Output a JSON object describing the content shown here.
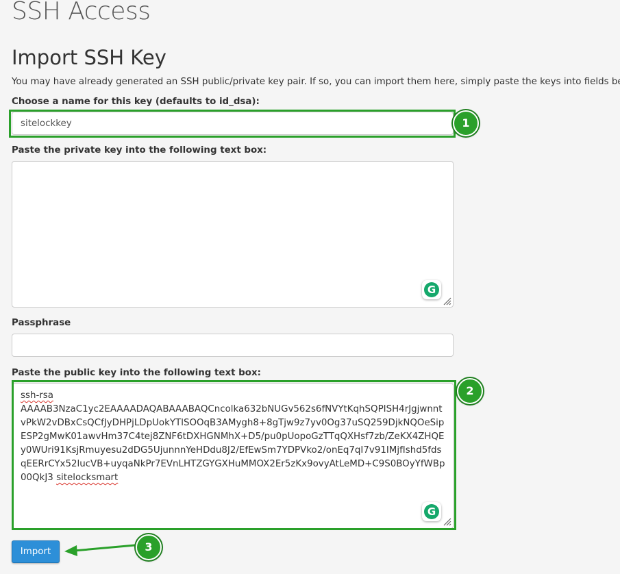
{
  "page": {
    "title": "SSH Access"
  },
  "section": {
    "title": "Import SSH Key",
    "intro": "You may have already generated an SSH public/private key pair. If so, you can import them here, simply paste the keys into fields below."
  },
  "key_name": {
    "label": "Choose a name for this key (defaults to id_dsa):",
    "value": "sitelockkey"
  },
  "private_key": {
    "label": "Paste the private key into the following text box:",
    "value": ""
  },
  "passphrase": {
    "label": "Passphrase",
    "value": ""
  },
  "public_key": {
    "label": "Paste the public key into the following text box:",
    "prefix": "ssh-rsa",
    "body": "AAAAB3NzaC1yc2EAAAADAQABAAABAQCncolka632bNUGv562s6fNVYtKqhSQPISH4rJgjwnntvPkW2vDBxCsQCfJyDHPjLDpUokYTlSOOqB3AMygh8+8gTjw9z7yv0Og37uSQ259DjkNQOeSipESP2gMwK01awvHm37C4tej8ZNF6tDXHGNMhX+D5/pu0pUopoGzTTqQXHsf7zb/ZeKX4ZHQEy0WUri91KsjRmuyesu2dDG5UjunnnYeHDdu8J2/EfEwSm7YDPVko2/onEq7qI7v91IMjfIshd5fdsqEERrCYx52lucVB+uyqaNkPr7EVnLHTZGYGXHuMMOX2Er5zKx9ovyAtLeMD+C9S0BOyYfWBp00QkJ3",
    "suffix": "sitelocksmart"
  },
  "grammarly": {
    "glyph": "G",
    "icon": "grammarly-icon"
  },
  "markers": [
    "1",
    "2",
    "3"
  ],
  "actions": {
    "import_label": "Import"
  },
  "colors": {
    "highlight": "#2aa02a",
    "button": "#2d8fd8"
  }
}
